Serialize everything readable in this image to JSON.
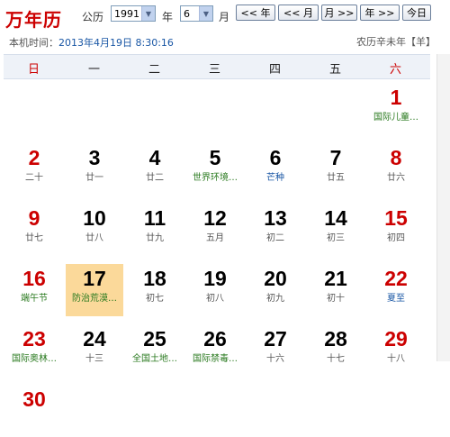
{
  "header": {
    "title": "万年历",
    "calendar_label": "公历",
    "year_value": "1991",
    "year_unit": "年",
    "month_value": "6",
    "month_unit": "月",
    "prev_year": "<< 年",
    "prev_month": "<< 月",
    "next_month": "月 >>",
    "next_year": "年 >>",
    "today": "今日"
  },
  "info": {
    "local_time_label": "本机时间：",
    "local_time": "2013年4月19日 8:30:16",
    "lunar_year": "农历辛未年【羊】"
  },
  "weekdays": [
    "日",
    "一",
    "二",
    "三",
    "四",
    "五",
    "六"
  ],
  "rows": [
    [
      null,
      null,
      null,
      null,
      null,
      null,
      {
        "day": "1",
        "sub": "国际儿童…"
      }
    ],
    [
      {
        "day": "2",
        "sub": "二十"
      },
      {
        "day": "3",
        "sub": "廿一"
      },
      {
        "day": "4",
        "sub": "廿二"
      },
      {
        "day": "5",
        "sub": "世界环境…"
      },
      {
        "day": "6",
        "sub": "芒种"
      },
      {
        "day": "7",
        "sub": "廿五"
      },
      {
        "day": "8",
        "sub": "廿六"
      }
    ],
    [
      {
        "day": "9",
        "sub": "廿七"
      },
      {
        "day": "10",
        "sub": "廿八"
      },
      {
        "day": "11",
        "sub": "廿九"
      },
      {
        "day": "12",
        "sub": "五月"
      },
      {
        "day": "13",
        "sub": "初二"
      },
      {
        "day": "14",
        "sub": "初三"
      },
      {
        "day": "15",
        "sub": "初四"
      }
    ],
    [
      {
        "day": "16",
        "sub": "端午节"
      },
      {
        "day": "17",
        "sub": "防治荒漠…"
      },
      {
        "day": "18",
        "sub": "初七"
      },
      {
        "day": "19",
        "sub": "初八"
      },
      {
        "day": "20",
        "sub": "初九"
      },
      {
        "day": "21",
        "sub": "初十"
      },
      {
        "day": "22",
        "sub": "夏至"
      }
    ],
    [
      {
        "day": "23",
        "sub": "国际奥林…"
      },
      {
        "day": "24",
        "sub": "十三"
      },
      {
        "day": "25",
        "sub": "全国土地…"
      },
      {
        "day": "26",
        "sub": "国际禁毒…"
      },
      {
        "day": "27",
        "sub": "十六"
      },
      {
        "day": "28",
        "sub": "十七"
      },
      {
        "day": "29",
        "sub": "十八"
      }
    ],
    [
      {
        "day": "30",
        "sub": ""
      },
      null,
      null,
      null,
      null,
      null,
      null
    ]
  ],
  "styles": {
    "holiday_color": "#2a7a1f",
    "solar_term_color": "#1a57a5",
    "weekend_color": "#cc0000",
    "today_bg": "#fbd99a"
  },
  "highlights": {
    "green": [
      "1",
      "5",
      "16",
      "17",
      "23",
      "25",
      "26"
    ],
    "blue": [
      "6",
      "22"
    ],
    "today": "17"
  }
}
